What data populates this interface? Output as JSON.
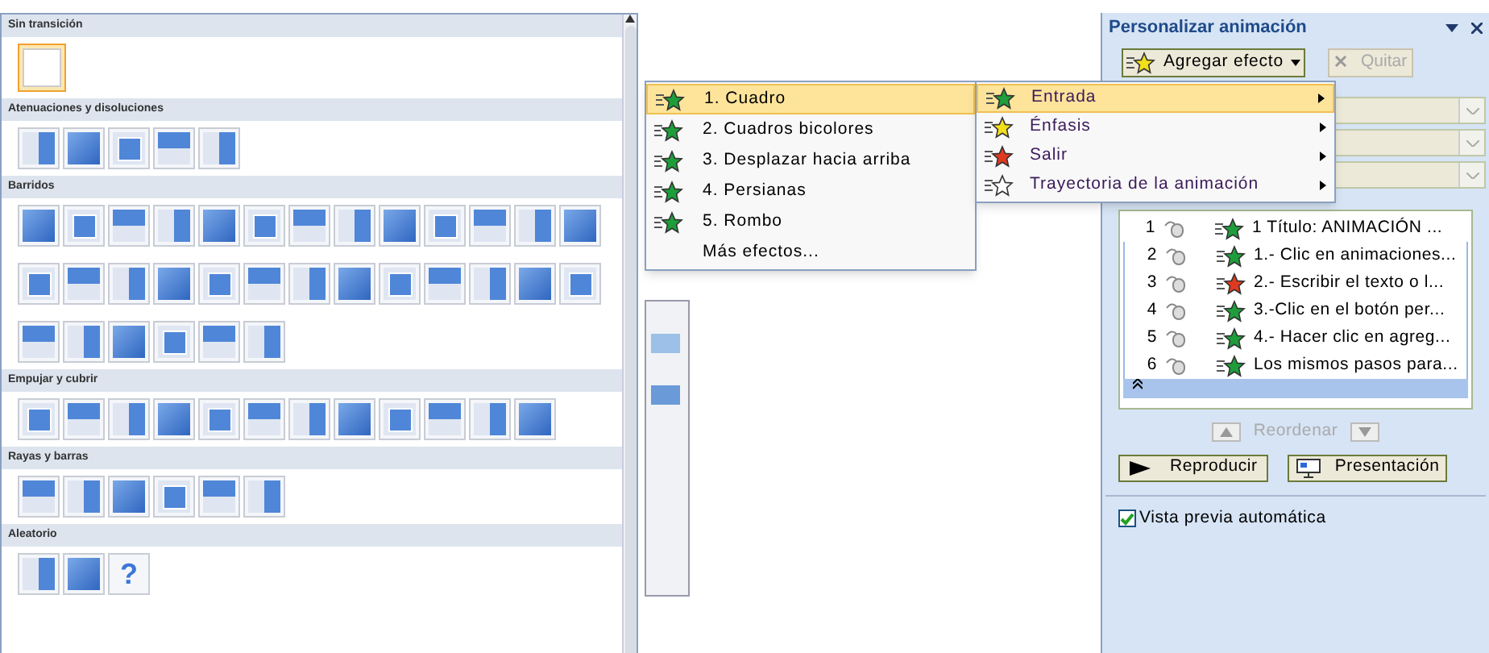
{
  "gallery": {
    "sections": [
      {
        "title": "Sin transición",
        "tiles": [
          {
            "selected": true
          }
        ]
      },
      {
        "title": "Atenuaciones y disoluciones",
        "tiles": [
          {
            "selected": false
          },
          {
            "selected": false
          },
          {
            "selected": false
          },
          {
            "selected": false
          },
          {
            "selected": false
          }
        ]
      },
      {
        "title": "Barridos",
        "tiles": [
          {
            "selected": false
          },
          {
            "selected": false
          },
          {
            "selected": false
          },
          {
            "selected": false
          },
          {
            "selected": false
          },
          {
            "selected": false
          },
          {
            "selected": false
          },
          {
            "selected": false
          },
          {
            "selected": false
          },
          {
            "selected": false
          },
          {
            "selected": false
          },
          {
            "selected": false
          },
          {
            "selected": false
          },
          {
            "selected": false
          },
          {
            "selected": false
          },
          {
            "selected": false
          },
          {
            "selected": false
          },
          {
            "selected": false
          },
          {
            "selected": false
          },
          {
            "selected": false
          },
          {
            "selected": false
          },
          {
            "selected": false
          },
          {
            "selected": false
          },
          {
            "selected": false
          },
          {
            "selected": false
          },
          {
            "selected": false
          },
          {
            "selected": false
          },
          {
            "selected": false
          },
          {
            "selected": false
          },
          {
            "selected": false
          },
          {
            "selected": false
          },
          {
            "selected": false
          }
        ]
      },
      {
        "title": "Empujar y cubrir",
        "tiles": [
          {
            "selected": false
          },
          {
            "selected": false
          },
          {
            "selected": false
          },
          {
            "selected": false
          },
          {
            "selected": false
          },
          {
            "selected": false
          },
          {
            "selected": false
          },
          {
            "selected": false
          },
          {
            "selected": false
          },
          {
            "selected": false
          },
          {
            "selected": false
          },
          {
            "selected": false
          }
        ]
      },
      {
        "title": "Rayas y barras",
        "tiles": [
          {
            "selected": false
          },
          {
            "selected": false
          },
          {
            "selected": false
          },
          {
            "selected": false
          },
          {
            "selected": false
          },
          {
            "selected": false
          }
        ]
      },
      {
        "title": "Aleatorio",
        "tiles": [
          {
            "selected": false
          },
          {
            "selected": false
          },
          {
            "selected": false,
            "glyph": "?"
          }
        ]
      }
    ]
  },
  "effects_submenu": [
    {
      "label": "1. Cuadro",
      "selected": true,
      "kind": "effect"
    },
    {
      "label": "2. Cuadros bicolores",
      "selected": false,
      "kind": "effect"
    },
    {
      "label": "3. Desplazar hacia arriba",
      "selected": false,
      "kind": "effect"
    },
    {
      "label": "4. Persianas",
      "selected": false,
      "kind": "effect"
    },
    {
      "label": "5. Rombo",
      "selected": false,
      "kind": "effect"
    },
    {
      "label": "Más efectos...",
      "selected": false,
      "kind": "more"
    }
  ],
  "effect_menu": [
    {
      "label": "Entrada",
      "selected": true,
      "color": "#1e9e3a"
    },
    {
      "label": "Énfasis",
      "selected": false,
      "color": "#f2e01a"
    },
    {
      "label": "Salir",
      "selected": false,
      "color": "#e03a1e"
    },
    {
      "label": "Trayectoria de la animación",
      "selected": false,
      "color": "#ffffff"
    }
  ],
  "panel": {
    "title": "Personalizar animación",
    "add_button": "Agregar efecto",
    "remove_button": {
      "label": "Quitar",
      "disabled": true
    },
    "animations": [
      {
        "number": "1",
        "text": "1 Título: ANIMACIÓN ...",
        "color": "#1e9e3a",
        "selected": false
      },
      {
        "number": "2",
        "text": "1.- Clic en animaciones...",
        "color": "#1e9e3a",
        "selected": true
      },
      {
        "number": "3",
        "text": "2.- Escribir el texto o l...",
        "color": "#e03a1e",
        "selected": true
      },
      {
        "number": "4",
        "text": "3.-Clic en el botón per...",
        "color": "#1e9e3a",
        "selected": true
      },
      {
        "number": "5",
        "text": "4.- Hacer clic en agreg...",
        "color": "#1e9e3a",
        "selected": true
      },
      {
        "number": "6",
        "text": "Los mismos pasos para...",
        "color": "#1e9e3a",
        "selected": true
      }
    ],
    "reorder_label": "Reordenar",
    "play_button": "Reproducir",
    "slideshow_button": "Presentación",
    "autopreview": {
      "label": "Vista previa automática",
      "checked": true
    }
  }
}
